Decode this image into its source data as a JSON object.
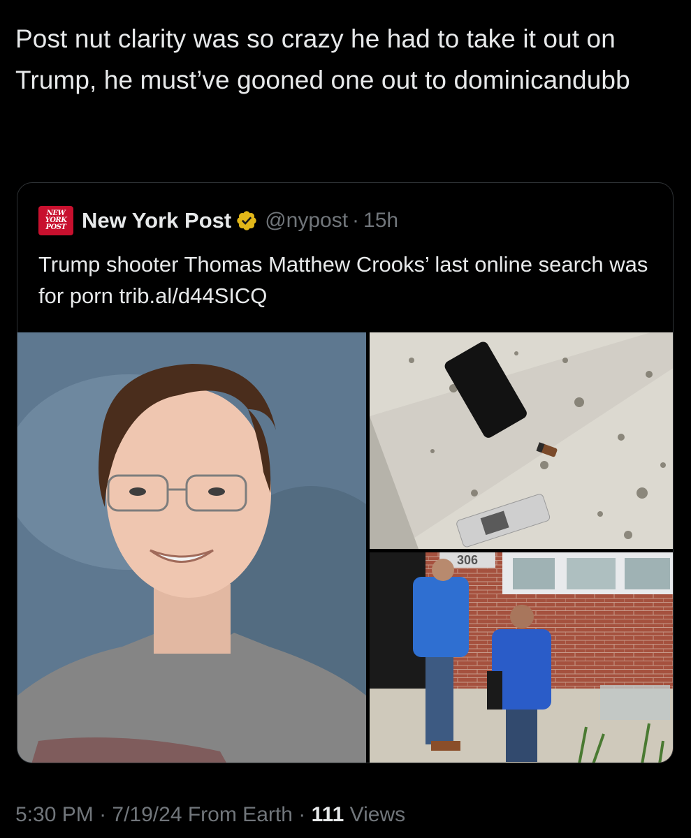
{
  "tweet": {
    "text": "Post nut clarity was so crazy he had to take it out on Trump, he must’ve gooned one out to dominicandubb",
    "timestamp": "5:30 PM",
    "date": "7/19/24",
    "source": "From Earth",
    "views_count": "111",
    "views_label": "Views",
    "separator": "·"
  },
  "quote": {
    "logo_lines": [
      "NEW",
      "YORK",
      "POST"
    ],
    "author_name": "New York Post",
    "verified_icon": "verified-gold-badge-icon",
    "handle": "@nypost",
    "separator": "·",
    "age": "15h",
    "text": "Trump shooter Thomas Matthew Crooks’ last online search was for porn trib.al/d44SICQ",
    "media": {
      "agents_photo_door_number": "306"
    }
  },
  "colors": {
    "background": "#000000",
    "text_primary": "#e7e9ea",
    "text_secondary": "#71767b",
    "card_border": "#2f3336",
    "logo_red": "#c8102e",
    "verified_gold": "#e2b719"
  }
}
